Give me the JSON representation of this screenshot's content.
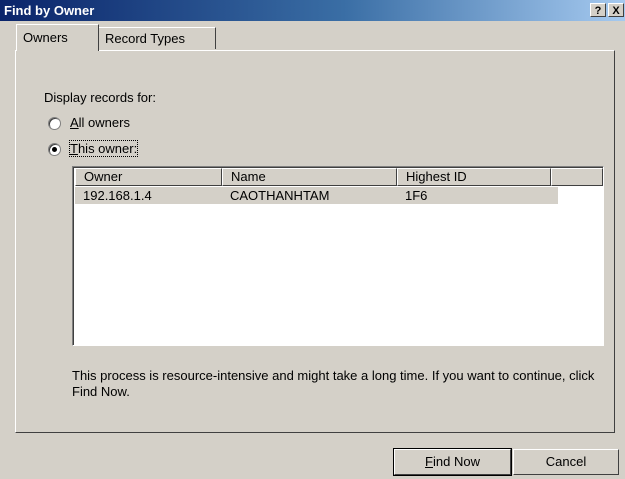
{
  "window": {
    "title": "Find by Owner",
    "help_glyph": "?",
    "close_glyph": "X"
  },
  "tabs": [
    {
      "label": "Owners"
    },
    {
      "label": "Record Types"
    }
  ],
  "display_label": "Display records for:",
  "radios": {
    "all": {
      "accel": "A",
      "rest": "ll owners",
      "selected": false
    },
    "this": {
      "accel": "T",
      "rest": "his owner:",
      "selected": true
    }
  },
  "list": {
    "columns": [
      "Owner",
      "Name",
      "Highest ID"
    ],
    "rows": [
      {
        "owner": "192.168.1.4",
        "name": "CAOTHANHTAM",
        "highest_id": "1F6"
      }
    ]
  },
  "note": "This process is resource-intensive and might take a long time.  If you want to continue, click Find Now.",
  "buttons": {
    "find_now": {
      "accel": "F",
      "rest": "ind Now"
    },
    "cancel": "Cancel"
  }
}
